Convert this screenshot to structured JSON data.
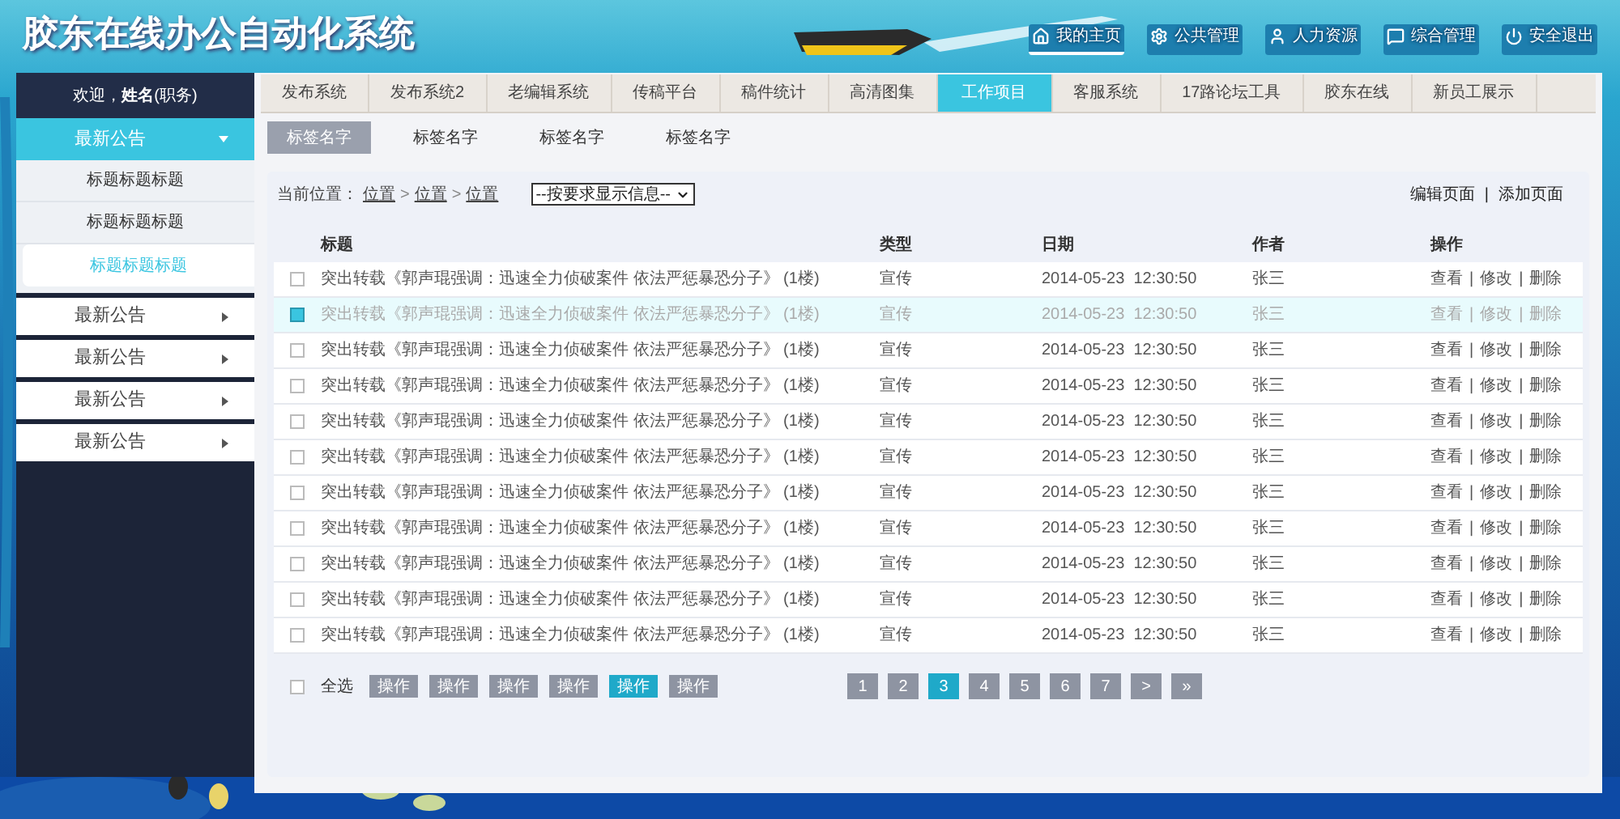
{
  "header": {
    "title": "胶东在线办公自动化系统",
    "nav": [
      {
        "kind": "home",
        "label": "我的主页",
        "selected": true
      },
      {
        "kind": "gear",
        "label": "公共管理",
        "selected": false
      },
      {
        "kind": "person",
        "label": "人力资源",
        "selected": false
      },
      {
        "kind": "chat",
        "label": "综合管理",
        "selected": false
      },
      {
        "kind": "power",
        "label": "安全退出",
        "selected": false
      }
    ]
  },
  "sidebar": {
    "welcome": "欢迎，**姓名**(职务)",
    "menus": [
      {
        "label": "最新公告",
        "expanded": true,
        "children": [
          {
            "label": "标题标题标题",
            "selected": false
          },
          {
            "label": "标题标题标题",
            "selected": false
          },
          {
            "label": "标题标题标题",
            "selected": true
          }
        ]
      },
      {
        "label": "最新公告",
        "expanded": false
      },
      {
        "label": "最新公告",
        "expanded": false
      },
      {
        "label": "最新公告",
        "expanded": false
      },
      {
        "label": "最新公告",
        "expanded": false
      }
    ]
  },
  "tabs": [
    {
      "label": "发布系统",
      "selected": false
    },
    {
      "label": "发布系统2",
      "selected": false
    },
    {
      "label": "老编辑系统",
      "selected": false
    },
    {
      "label": "传稿平台",
      "selected": false
    },
    {
      "label": "稿件统计",
      "selected": false
    },
    {
      "label": "高清图集",
      "selected": false
    },
    {
      "label": "工作项目",
      "selected": true
    },
    {
      "label": "客服系统",
      "selected": false
    },
    {
      "label": "17路论坛工具",
      "selected": false
    },
    {
      "label": "胶东在线",
      "selected": false
    },
    {
      "label": "新员工展示",
      "selected": false
    }
  ],
  "subtabs": [
    {
      "label": "标签名字",
      "selected": true
    },
    {
      "label": "标签名字",
      "selected": false
    },
    {
      "label": "标签名字",
      "selected": false
    },
    {
      "label": "标签名字",
      "selected": false
    }
  ],
  "breadcrumb": {
    "prefix": "当前位置：",
    "separator": ">",
    "items": [
      "位置",
      "位置",
      "位置"
    ]
  },
  "filter": {
    "value": "--按要求显示信息--"
  },
  "page_actions": {
    "items": [
      "编辑页面",
      "添加页面"
    ],
    "separator": "|"
  },
  "table": {
    "columns": [
      "标题",
      "类型",
      "日期",
      "作者",
      "操作"
    ],
    "action_separator": "|",
    "rows": [
      {
        "checked": false,
        "title": "突出转载《郭声琨强调：迅速全力侦破案件 依法严惩暴恐分子》 (1楼)",
        "type": "宣传",
        "date": "2014-05-23  12:30:50",
        "author": "张三",
        "actions": [
          "查看",
          "修改",
          "删除"
        ]
      },
      {
        "checked": true,
        "title": "突出转载《郭声琨强调：迅速全力侦破案件 依法严惩暴恐分子》 (1楼)",
        "type": "宣传",
        "date": "2014-05-23  12:30:50",
        "author": "张三",
        "actions": [
          "查看",
          "修改",
          "删除"
        ]
      },
      {
        "checked": false,
        "title": "突出转载《郭声琨强调：迅速全力侦破案件 依法严惩暴恐分子》 (1楼)",
        "type": "宣传",
        "date": "2014-05-23  12:30:50",
        "author": "张三",
        "actions": [
          "查看",
          "修改",
          "删除"
        ]
      },
      {
        "checked": false,
        "title": "突出转载《郭声琨强调：迅速全力侦破案件 依法严惩暴恐分子》 (1楼)",
        "type": "宣传",
        "date": "2014-05-23  12:30:50",
        "author": "张三",
        "actions": [
          "查看",
          "修改",
          "删除"
        ]
      },
      {
        "checked": false,
        "title": "突出转载《郭声琨强调：迅速全力侦破案件 依法严惩暴恐分子》 (1楼)",
        "type": "宣传",
        "date": "2014-05-23  12:30:50",
        "author": "张三",
        "actions": [
          "查看",
          "修改",
          "删除"
        ]
      },
      {
        "checked": false,
        "title": "突出转载《郭声琨强调：迅速全力侦破案件 依法严惩暴恐分子》 (1楼)",
        "type": "宣传",
        "date": "2014-05-23  12:30:50",
        "author": "张三",
        "actions": [
          "查看",
          "修改",
          "删除"
        ]
      },
      {
        "checked": false,
        "title": "突出转载《郭声琨强调：迅速全力侦破案件 依法严惩暴恐分子》 (1楼)",
        "type": "宣传",
        "date": "2014-05-23  12:30:50",
        "author": "张三",
        "actions": [
          "查看",
          "修改",
          "删除"
        ]
      },
      {
        "checked": false,
        "title": "突出转载《郭声琨强调：迅速全力侦破案件 依法严惩暴恐分子》 (1楼)",
        "type": "宣传",
        "date": "2014-05-23  12:30:50",
        "author": "张三",
        "actions": [
          "查看",
          "修改",
          "删除"
        ]
      },
      {
        "checked": false,
        "title": "突出转载《郭声琨强调：迅速全力侦破案件 依法严惩暴恐分子》 (1楼)",
        "type": "宣传",
        "date": "2014-05-23  12:30:50",
        "author": "张三",
        "actions": [
          "查看",
          "修改",
          "删除"
        ]
      },
      {
        "checked": false,
        "title": "突出转载《郭声琨强调：迅速全力侦破案件 依法严惩暴恐分子》 (1楼)",
        "type": "宣传",
        "date": "2014-05-23  12:30:50",
        "author": "张三",
        "actions": [
          "查看",
          "修改",
          "删除"
        ]
      },
      {
        "checked": false,
        "title": "突出转载《郭声琨强调：迅速全力侦破案件 依法严惩暴恐分子》 (1楼)",
        "type": "宣传",
        "date": "2014-05-23  12:30:50",
        "author": "张三",
        "actions": [
          "查看",
          "修改",
          "删除"
        ]
      }
    ]
  },
  "footer": {
    "select_all": {
      "label": "全选",
      "checked": false
    },
    "buttons": [
      {
        "label": "操作",
        "selected": false
      },
      {
        "label": "操作",
        "selected": false
      },
      {
        "label": "操作",
        "selected": false
      },
      {
        "label": "操作",
        "selected": false
      },
      {
        "label": "操作",
        "selected": true
      },
      {
        "label": "操作",
        "selected": false
      }
    ],
    "pagination": [
      {
        "label": "1",
        "selected": false
      },
      {
        "label": "2",
        "selected": false
      },
      {
        "label": "3",
        "selected": true
      },
      {
        "label": "4",
        "selected": false
      },
      {
        "label": "5",
        "selected": false
      },
      {
        "label": "6",
        "selected": false
      },
      {
        "label": "7",
        "selected": false
      },
      {
        "label": ">",
        "selected": false
      },
      {
        "label": "»",
        "selected": false
      }
    ]
  }
}
